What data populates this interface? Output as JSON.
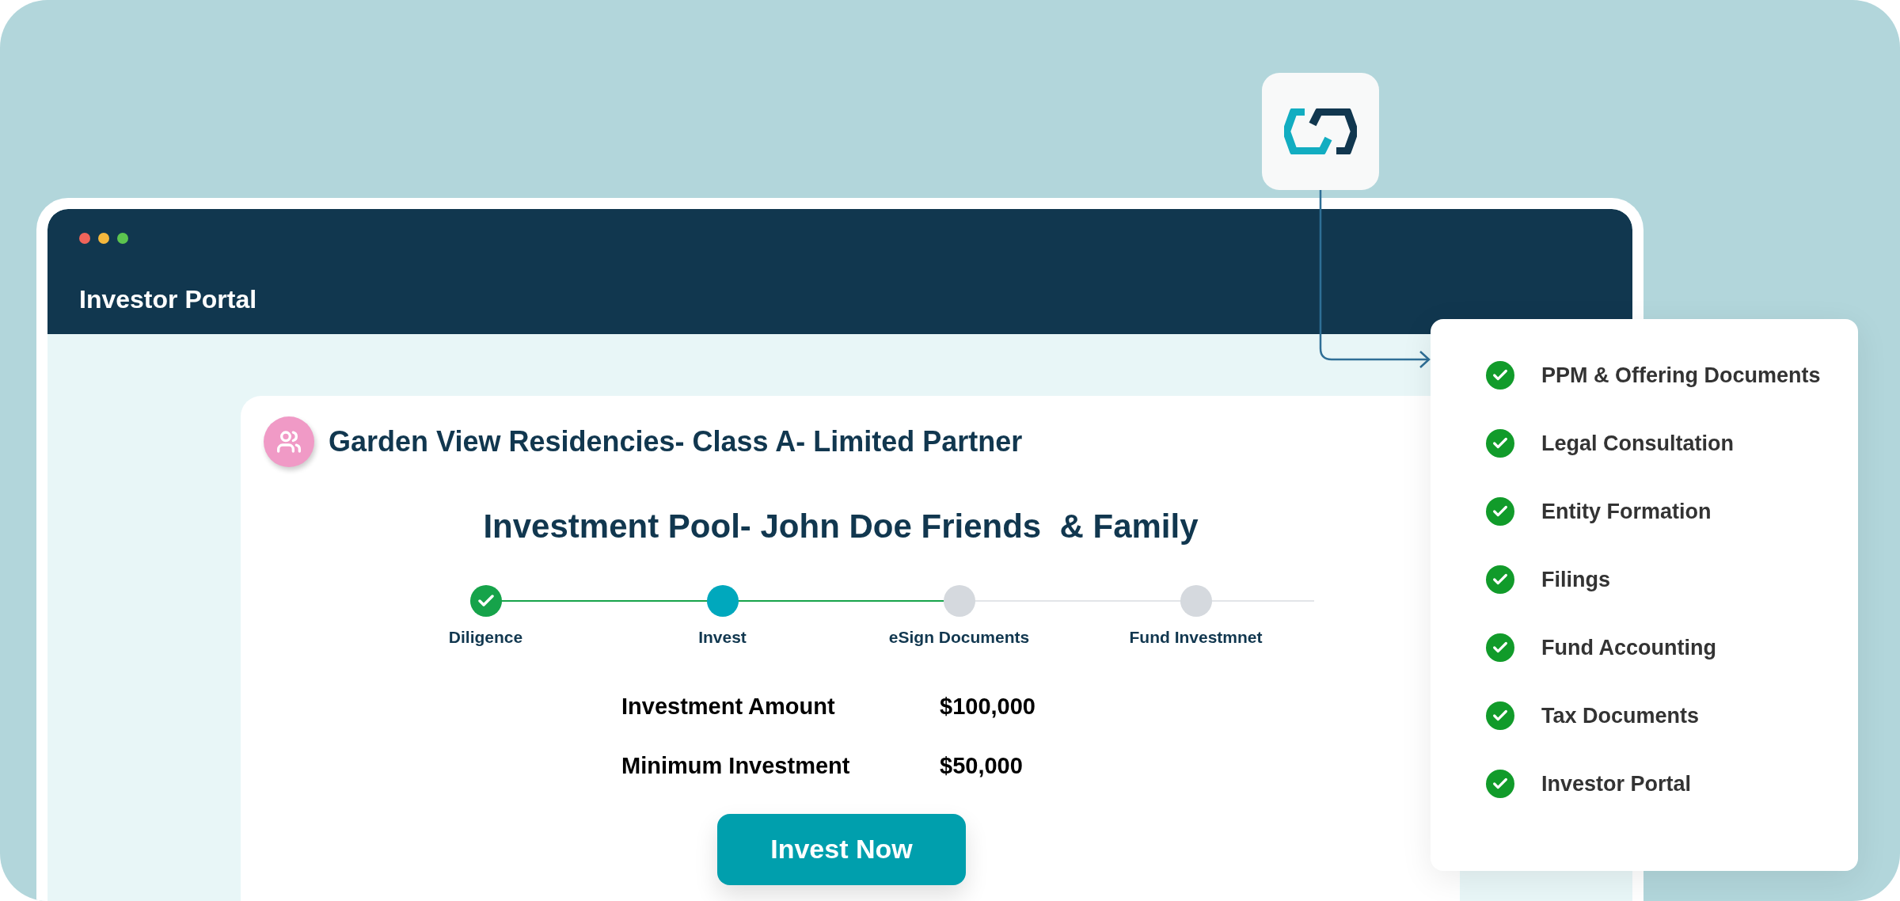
{
  "window": {
    "title": "Investor Portal"
  },
  "offering": {
    "title": "Garden View Residencies- Class A- Limited Partner",
    "pool_title": "Investment Pool- John Doe Friends  & Family",
    "steps": [
      {
        "label": "Diligence",
        "kind": "done"
      },
      {
        "label": "Invest",
        "kind": "current"
      },
      {
        "label": "eSign Documents",
        "kind": "pending"
      },
      {
        "label": "Fund Investmnet",
        "kind": "pending"
      }
    ],
    "details": [
      {
        "label": "Investment Amount",
        "value": "$100,000"
      },
      {
        "label": "Minimum Investment",
        "value": "$50,000"
      }
    ],
    "button": "Invest Now"
  },
  "services": [
    {
      "label": "PPM & Offering Documents",
      "checked": true
    },
    {
      "label": "Legal Consultation",
      "checked": true
    },
    {
      "label": "Entity Formation",
      "checked": true
    },
    {
      "label": "Filings",
      "checked": true
    },
    {
      "label": "Fund Accounting",
      "checked": true
    },
    {
      "label": "Tax Documents",
      "checked": true
    },
    {
      "label": "Investor Portal",
      "checked": true
    }
  ]
}
